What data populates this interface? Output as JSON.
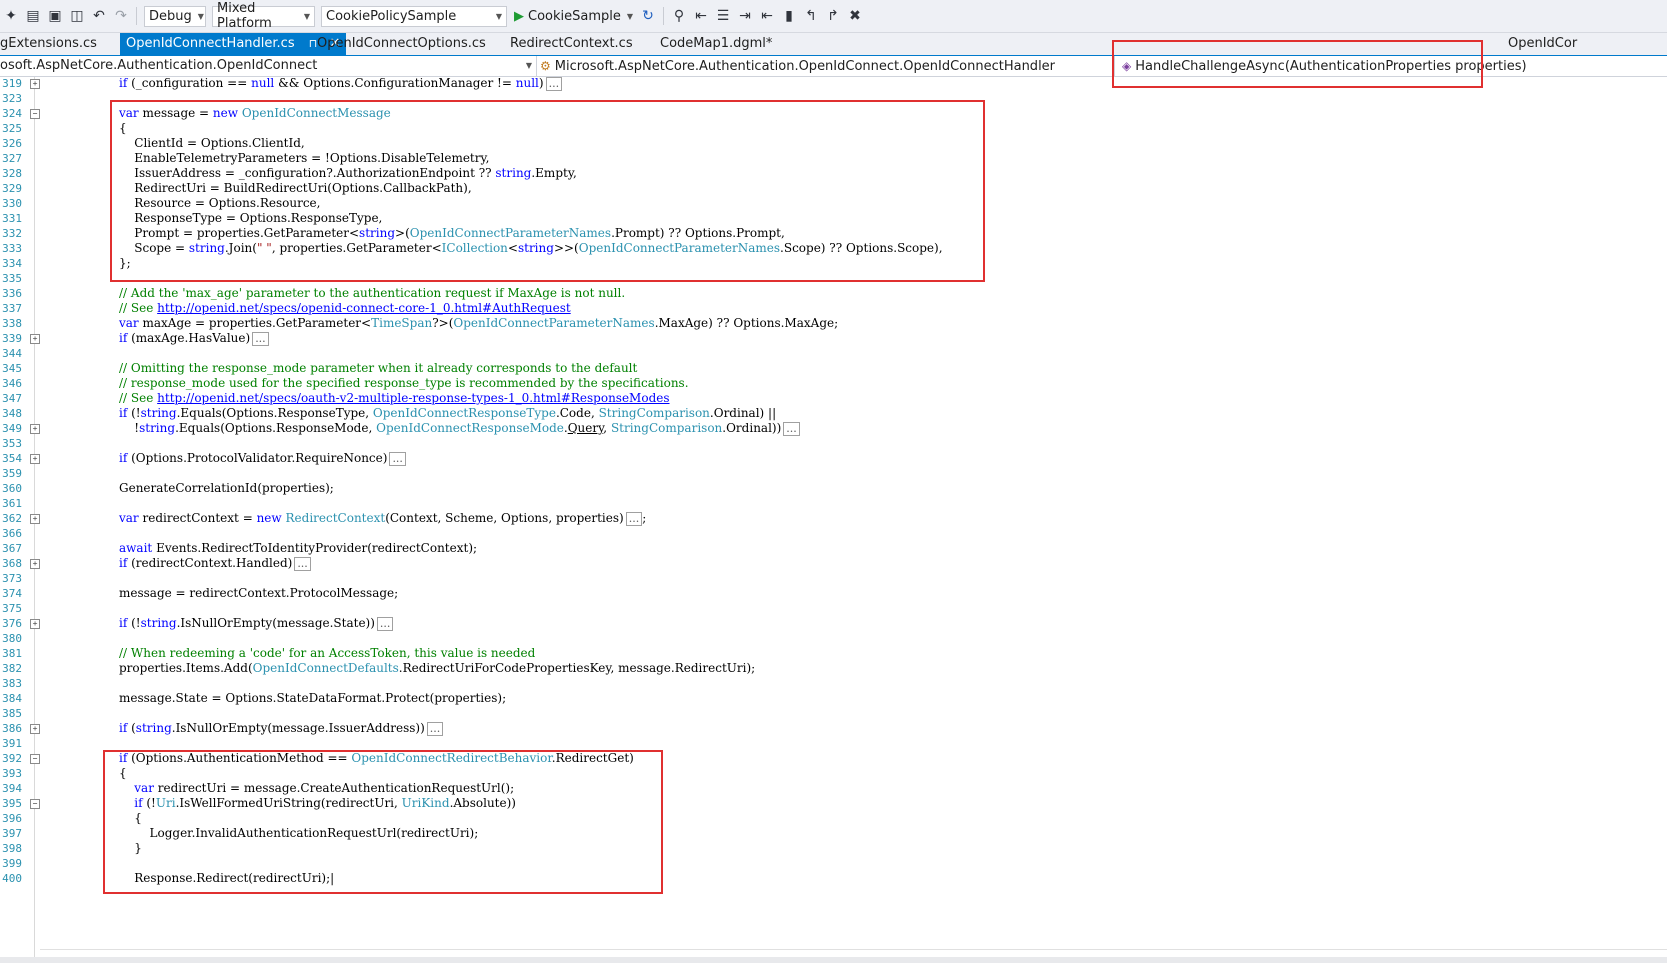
{
  "toolbar": {
    "config": "Debug",
    "platform": "Mixed Platform",
    "project": "CookiePolicySample",
    "run_target": "CookieSample"
  },
  "tabs": [
    {
      "label": "gExtensions.cs",
      "active": false
    },
    {
      "label": "OpenIdConnectHandler.cs",
      "active": true
    },
    {
      "label": "OpenIdConnectOptions.cs",
      "active": false
    },
    {
      "label": "RedirectContext.cs",
      "active": false
    },
    {
      "label": "CodeMap1.dgml*",
      "active": false
    },
    {
      "label": "OpenIdCor",
      "active": false
    }
  ],
  "navbar": {
    "project": "osoft.AspNetCore.Authentication.OpenIdConnect",
    "type": "Microsoft.AspNetCore.Authentication.OpenIdConnect.OpenIdConnectHandler",
    "member": "HandleChallengeAsync(AuthenticationProperties properties)"
  },
  "code_lines": [
    {
      "n": "319",
      "fold": "+",
      "html": "<span class='kw'>if</span> (_configuration == <span class='kw'>null</span> &amp;&amp; Options.ConfigurationManager != <span class='kw'>null</span>)<span class='coll'>...</span>"
    },
    {
      "n": "323",
      "fold": "",
      "html": ""
    },
    {
      "n": "324",
      "fold": "-",
      "html": "<span class='kw'>var</span> message = <span class='kw'>new</span> <span class='ty'>OpenIdConnectMessage</span>"
    },
    {
      "n": "325",
      "fold": "",
      "html": "{"
    },
    {
      "n": "326",
      "fold": "",
      "html": "    ClientId = Options.ClientId,"
    },
    {
      "n": "327",
      "fold": "",
      "html": "    EnableTelemetryParameters = !Options.DisableTelemetry,"
    },
    {
      "n": "328",
      "fold": "",
      "html": "    IssuerAddress = _configuration?.AuthorizationEndpoint ?? <span class='kw'>string</span>.Empty,"
    },
    {
      "n": "329",
      "fold": "",
      "html": "    RedirectUri = BuildRedirectUri(Options.CallbackPath),"
    },
    {
      "n": "330",
      "fold": "",
      "html": "    Resource = Options.Resource,"
    },
    {
      "n": "331",
      "fold": "",
      "html": "    ResponseType = Options.ResponseType,"
    },
    {
      "n": "332",
      "fold": "",
      "html": "    Prompt = properties.GetParameter&lt;<span class='kw'>string</span>&gt;(<span class='ty'>OpenIdConnectParameterNames</span>.Prompt) ?? Options.Prompt,"
    },
    {
      "n": "333",
      "fold": "",
      "html": "    Scope = <span class='kw'>string</span>.Join(<span class='st'>\" \"</span>, properties.GetParameter&lt;<span class='ty'>ICollection</span>&lt;<span class='kw'>string</span>&gt;&gt;(<span class='ty'>OpenIdConnectParameterNames</span>.Scope) ?? Options.Scope),"
    },
    {
      "n": "334",
      "fold": "",
      "html": "};"
    },
    {
      "n": "335",
      "fold": "",
      "html": ""
    },
    {
      "n": "336",
      "fold": "",
      "html": "<span class='cm'>// Add the 'max_age' parameter to the authentication request if MaxAge is not null.</span>"
    },
    {
      "n": "337",
      "fold": "",
      "html": "<span class='cm'>// See </span><span class='lk'>http://openid.net/specs/openid-connect-core-1_0.html#AuthRequest</span>"
    },
    {
      "n": "338",
      "fold": "",
      "html": "<span class='kw'>var</span> maxAge = properties.GetParameter&lt;<span class='ty'>TimeSpan</span>?&gt;(<span class='ty'>OpenIdConnectParameterNames</span>.MaxAge) ?? Options.MaxAge;"
    },
    {
      "n": "339",
      "fold": "+",
      "html": "<span class='kw'>if</span> (maxAge.HasValue)<span class='coll'>...</span>"
    },
    {
      "n": "344",
      "fold": "",
      "html": ""
    },
    {
      "n": "345",
      "fold": "",
      "html": "<span class='cm'>// Omitting the response_mode parameter when it already corresponds to the default</span>"
    },
    {
      "n": "346",
      "fold": "",
      "html": "<span class='cm'>// response_mode used for the specified response_type is recommended by the specifications.</span>"
    },
    {
      "n": "347",
      "fold": "",
      "html": "<span class='cm'>// See </span><span class='lk'>http://openid.net/specs/oauth-v2-multiple-response-types-1_0.html#ResponseModes</span>"
    },
    {
      "n": "348",
      "fold": "",
      "html": "<span class='kw'>if</span> (!<span class='kw'>string</span>.Equals(Options.ResponseType, <span class='ty'>OpenIdConnectResponseType</span>.Code, <span class='ty'>StringComparison</span>.Ordinal) ||"
    },
    {
      "n": "349",
      "fold": "+",
      "html": "    !<span class='kw'>string</span>.Equals(Options.ResponseMode, <span class='ty'>OpenIdConnectResponseMode</span>.<u>Query</u>, <span class='ty'>StringComparison</span>.Ordinal))<span class='coll'>...</span>"
    },
    {
      "n": "353",
      "fold": "",
      "html": ""
    },
    {
      "n": "354",
      "fold": "+",
      "html": "<span class='kw'>if</span> (Options.ProtocolValidator.RequireNonce)<span class='coll'>...</span>"
    },
    {
      "n": "359",
      "fold": "",
      "html": ""
    },
    {
      "n": "360",
      "fold": "",
      "html": "GenerateCorrelationId(properties);"
    },
    {
      "n": "361",
      "fold": "",
      "html": ""
    },
    {
      "n": "362",
      "fold": "+",
      "html": "<span class='kw'>var</span> redirectContext = <span class='kw'>new</span> <span class='ty'>RedirectContext</span>(Context, Scheme, Options, properties)<span class='coll'>...</span>;"
    },
    {
      "n": "366",
      "fold": "",
      "html": ""
    },
    {
      "n": "367",
      "fold": "",
      "html": "<span class='kw'>await</span> Events.RedirectToIdentityProvider(redirectContext);"
    },
    {
      "n": "368",
      "fold": "+",
      "html": "<span class='kw'>if</span> (redirectContext.Handled)<span class='coll'>...</span>"
    },
    {
      "n": "373",
      "fold": "",
      "html": ""
    },
    {
      "n": "374",
      "fold": "",
      "html": "message = redirectContext.ProtocolMessage;"
    },
    {
      "n": "375",
      "fold": "",
      "html": ""
    },
    {
      "n": "376",
      "fold": "+",
      "html": "<span class='kw'>if</span> (!<span class='kw'>string</span>.IsNullOrEmpty(message.State))<span class='coll'>...</span>"
    },
    {
      "n": "380",
      "fold": "",
      "html": ""
    },
    {
      "n": "381",
      "fold": "",
      "html": "<span class='cm'>// When redeeming a 'code' for an AccessToken, this value is needed</span>"
    },
    {
      "n": "382",
      "fold": "",
      "html": "properties.Items.Add(<span class='ty'>OpenIdConnectDefaults</span>.RedirectUriForCodePropertiesKey, message.RedirectUri);"
    },
    {
      "n": "383",
      "fold": "",
      "html": ""
    },
    {
      "n": "384",
      "fold": "",
      "html": "message.State = Options.StateDataFormat.Protect(properties);"
    },
    {
      "n": "385",
      "fold": "",
      "html": ""
    },
    {
      "n": "386",
      "fold": "+",
      "html": "<span class='kw'>if</span> (<span class='kw'>string</span>.IsNullOrEmpty(message.IssuerAddress))<span class='coll'>...</span>"
    },
    {
      "n": "391",
      "fold": "",
      "html": ""
    },
    {
      "n": "392",
      "fold": "-",
      "html": "<span class='kw'>if</span> (Options.AuthenticationMethod == <span class='ty'>OpenIdConnectRedirectBehavior</span>.RedirectGet)"
    },
    {
      "n": "393",
      "fold": "",
      "html": "{"
    },
    {
      "n": "394",
      "fold": "",
      "html": "    <span class='kw'>var</span> redirectUri = message.CreateAuthenticationRequestUrl();"
    },
    {
      "n": "395",
      "fold": "-",
      "html": "    <span class='kw'>if</span> (!<span class='ty'>Uri</span>.IsWellFormedUriString(redirectUri, <span class='ty'>UriKind</span>.Absolute))"
    },
    {
      "n": "396",
      "fold": "",
      "html": "    {"
    },
    {
      "n": "397",
      "fold": "",
      "html": "        Logger.InvalidAuthenticationRequestUrl(redirectUri);"
    },
    {
      "n": "398",
      "fold": "",
      "html": "    }"
    },
    {
      "n": "399",
      "fold": "",
      "html": ""
    },
    {
      "n": "400",
      "fold": "",
      "html": "    Response.Redirect(redirectUri);|"
    }
  ]
}
